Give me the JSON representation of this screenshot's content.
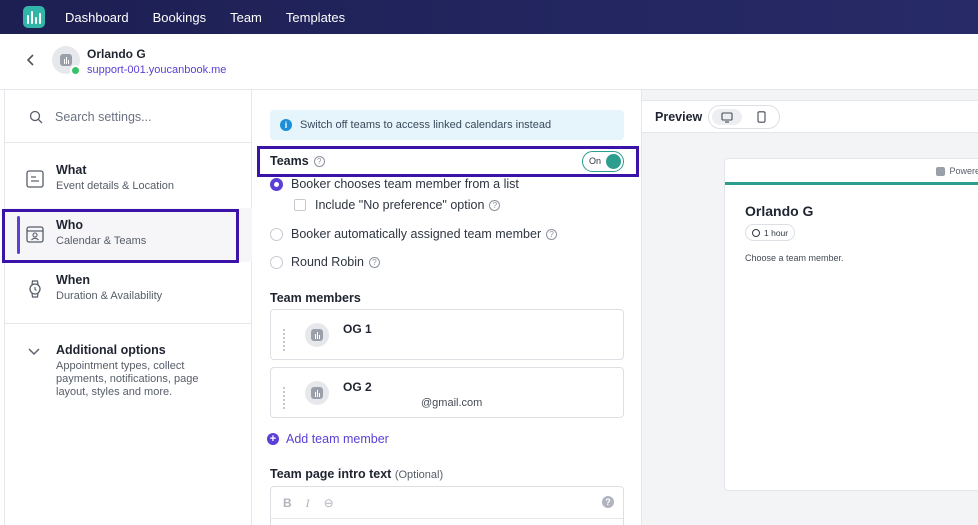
{
  "nav": {
    "items": [
      "Dashboard",
      "Bookings",
      "Team",
      "Templates"
    ]
  },
  "header": {
    "name": "Orlando G",
    "url": "support-001.youcanbook.me"
  },
  "sidebar": {
    "search_placeholder": "Search settings...",
    "items": [
      {
        "title": "What",
        "subtitle": "Event details & Location"
      },
      {
        "title": "Who",
        "subtitle": "Calendar & Teams"
      },
      {
        "title": "When",
        "subtitle": "Duration & Availability"
      }
    ],
    "additional": {
      "title": "Additional options",
      "description": "Appointment types, collect payments, notifications, page layout, styles and more."
    }
  },
  "main": {
    "banner": "Switch off teams to access linked calendars instead",
    "teams_label": "Teams",
    "toggle_label": "On",
    "options": {
      "list": "Booker chooses team member from a list",
      "no_pref": "Include \"No preference\" option",
      "auto": "Booker automatically assigned team member",
      "round_robin": "Round Robin"
    },
    "team_members_title": "Team members",
    "members": [
      {
        "name": "OG 1",
        "email": ""
      },
      {
        "name": "OG 2",
        "email": "@gmail.com"
      }
    ],
    "add_member": "Add team member",
    "intro_title": "Team page intro text",
    "intro_optional": "(Optional)",
    "editor_tools": [
      "B",
      "I",
      "⊖"
    ]
  },
  "preview": {
    "label": "Preview",
    "powered": "Powere",
    "name": "Orlando G",
    "duration": "1 hour",
    "description": "Choose a team member."
  },
  "colors": {
    "accent": "#5b3fd6",
    "teal": "#2d9d8f",
    "highlight": "#3c13a8",
    "nav_bg": "#1d1f52"
  }
}
